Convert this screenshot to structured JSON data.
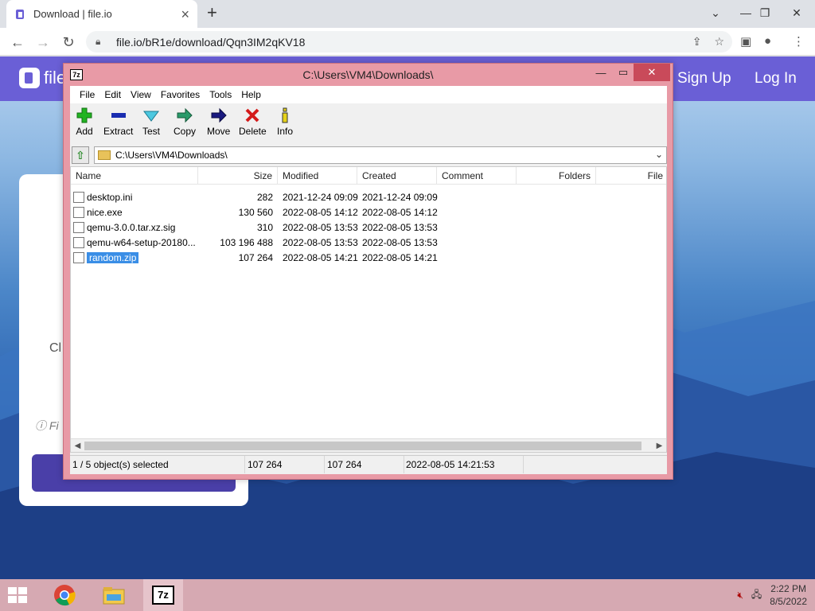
{
  "browser": {
    "tab_title": "Download | file.io",
    "url": "file.io/bR1e/download/Qqn3IM2qKV18"
  },
  "site": {
    "name": "file",
    "nav": [
      "Sign Up",
      "Log In"
    ],
    "card_text": "Cl",
    "card_info": "Fi"
  },
  "zip": {
    "title": "C:\\Users\\VM4\\Downloads\\",
    "menu": [
      "File",
      "Edit",
      "View",
      "Favorites",
      "Tools",
      "Help"
    ],
    "tools": [
      {
        "label": "Add",
        "icon": "add-icon",
        "color": "#22b422"
      },
      {
        "label": "Extract",
        "icon": "extract-icon",
        "color": "#1a2db0"
      },
      {
        "label": "Test",
        "icon": "test-icon",
        "color": "#4cc8e0"
      },
      {
        "label": "Copy",
        "icon": "copy-icon",
        "color": "#2a9a6a"
      },
      {
        "label": "Move",
        "icon": "move-icon",
        "color": "#1a1a80"
      },
      {
        "label": "Delete",
        "icon": "delete-icon",
        "color": "#d41a1a"
      },
      {
        "label": "Info",
        "icon": "info-icon",
        "color": "#e6d21a"
      }
    ],
    "path": "C:\\Users\\VM4\\Downloads\\",
    "columns": [
      "Name",
      "Size",
      "Modified",
      "Created",
      "Comment",
      "Folders",
      "File"
    ],
    "files": [
      {
        "name": "desktop.ini",
        "size": "282",
        "modified": "2021-12-24 09:09",
        "created": "2021-12-24 09:09",
        "icon": "settings-file-icon"
      },
      {
        "name": "nice.exe",
        "size": "130 560",
        "modified": "2022-08-05 14:12",
        "created": "2022-08-05 14:12",
        "icon": "exe-file-icon"
      },
      {
        "name": "qemu-3.0.0.tar.xz.sig",
        "size": "310",
        "modified": "2022-08-05 13:53",
        "created": "2022-08-05 13:53",
        "icon": "file-icon"
      },
      {
        "name": "qemu-w64-setup-20180...",
        "size": "103 196 488",
        "modified": "2022-08-05 13:53",
        "created": "2022-08-05 13:53",
        "icon": "exe-file-icon"
      },
      {
        "name": "random.zip",
        "size": "107 264",
        "modified": "2022-08-05 14:21",
        "created": "2022-08-05 14:21",
        "icon": "zip-file-icon",
        "selected": true
      }
    ],
    "status": {
      "selection": "1 / 5 object(s) selected",
      "size": "107 264",
      "packed": "107 264",
      "datetime": "2022-08-05 14:21:53"
    }
  },
  "taskbar": {
    "apps": [
      "chrome-icon",
      "file-explorer-icon",
      "7zip-icon"
    ],
    "time": "2:22 PM",
    "date": "8/5/2022"
  },
  "colors": {
    "site_header": "#6a5fd6",
    "zip_frame": "#e89aa6",
    "selection": "#3a8ee6",
    "taskbar": "#d6a9b2"
  }
}
